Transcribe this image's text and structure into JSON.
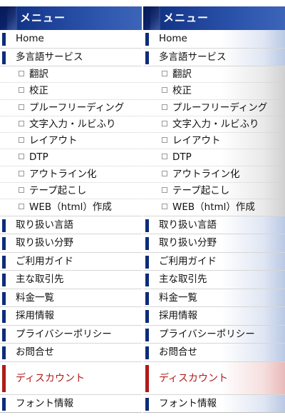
{
  "menu": {
    "title": "メニュー",
    "home": "Home",
    "multilingual": "多言語サービス",
    "sub_items": [
      "翻訳",
      "校正",
      "プルーフリーディング",
      "文字入力・ルビふり",
      "レイアウト",
      "DTP",
      "アウトライン化",
      "テープ起こし",
      "WEB（html）作成"
    ],
    "main_items": [
      "取り扱い言語",
      "取り扱い分野",
      "ご利用ガイド",
      "主な取引先",
      "料金一覧",
      "採用情報",
      "プライバシーポリシー",
      "お問合せ"
    ],
    "discount": "ディスカウント",
    "font_info": "フォント情報"
  },
  "colors": {
    "header_navy": "#0d2c7a",
    "discount_red": "#b01a1a"
  }
}
